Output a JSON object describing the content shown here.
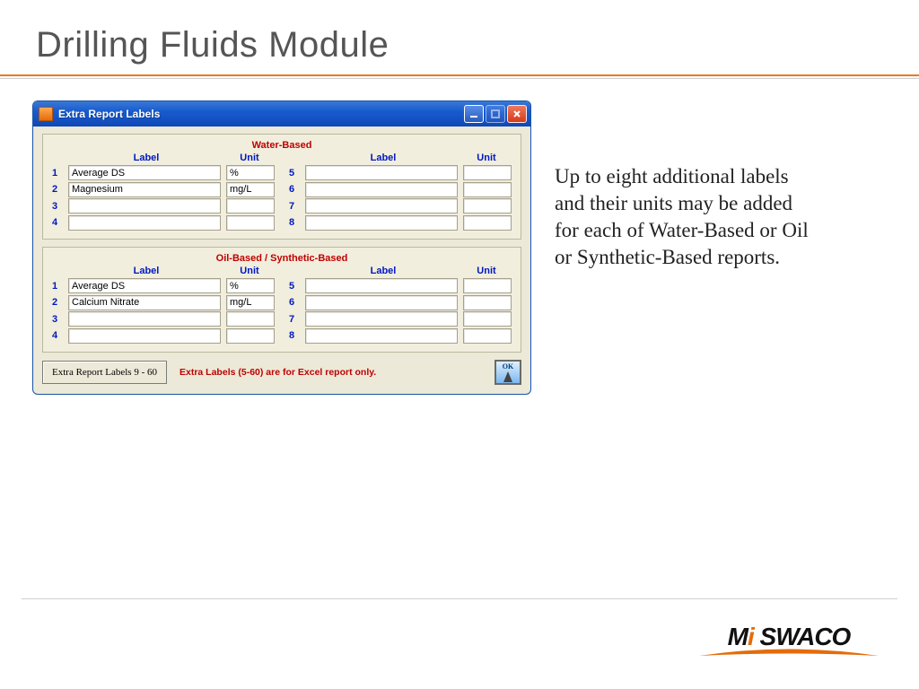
{
  "slide": {
    "title": "Drilling Fluids Module"
  },
  "annotation": {
    "text": "Up to eight additional labels and their units may be added for each of Water-Based or Oil or Synthetic-Based reports."
  },
  "window": {
    "title": "Extra Report Labels",
    "min_tip": "Minimize",
    "max_tip": "Maximize",
    "close_tip": "Close"
  },
  "headers": {
    "label": "Label",
    "unit": "Unit"
  },
  "water": {
    "title": "Water-Based",
    "left": [
      {
        "n": "1",
        "label": "Average DS",
        "unit": "%"
      },
      {
        "n": "2",
        "label": "Magnesium",
        "unit": "mg/L"
      },
      {
        "n": "3",
        "label": "",
        "unit": ""
      },
      {
        "n": "4",
        "label": "",
        "unit": ""
      }
    ],
    "right": [
      {
        "n": "5",
        "label": "",
        "unit": ""
      },
      {
        "n": "6",
        "label": "",
        "unit": ""
      },
      {
        "n": "7",
        "label": "",
        "unit": ""
      },
      {
        "n": "8",
        "label": "",
        "unit": ""
      }
    ]
  },
  "oil": {
    "title": "Oil-Based / Synthetic-Based",
    "left": [
      {
        "n": "1",
        "label": "Average DS",
        "unit": "%"
      },
      {
        "n": "2",
        "label": "Calcium Nitrate",
        "unit": "mg/L"
      },
      {
        "n": "3",
        "label": "",
        "unit": ""
      },
      {
        "n": "4",
        "label": "",
        "unit": ""
      }
    ],
    "right": [
      {
        "n": "5",
        "label": "",
        "unit": ""
      },
      {
        "n": "6",
        "label": "",
        "unit": ""
      },
      {
        "n": "7",
        "label": "",
        "unit": ""
      },
      {
        "n": "8",
        "label": "",
        "unit": ""
      }
    ]
  },
  "bottom": {
    "extra_button": "Extra Report Labels 9 - 60",
    "note": "Extra Labels (5-60) are for Excel report only.",
    "ok": "OK"
  },
  "logo": {
    "text_before_i": "M",
    "i": "i",
    "text_after_i": " SWACO"
  }
}
